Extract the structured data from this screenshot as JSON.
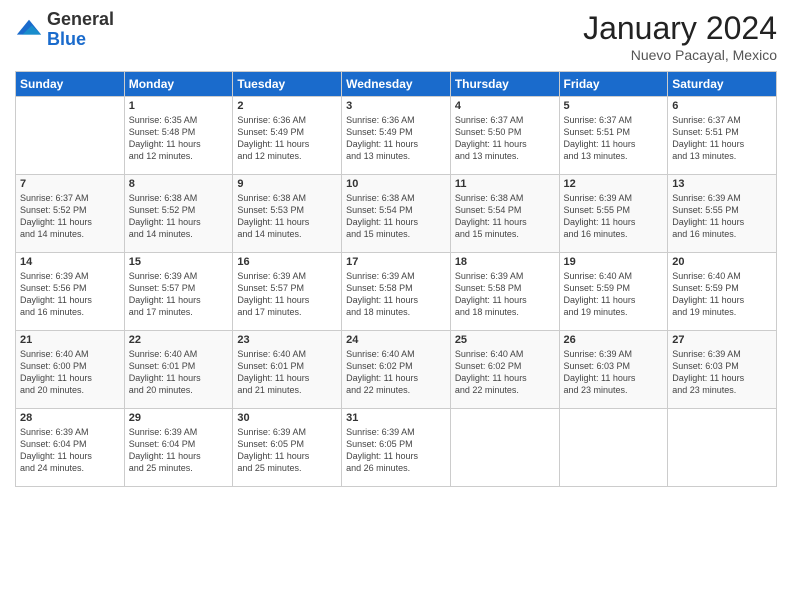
{
  "logo": {
    "general": "General",
    "blue": "Blue"
  },
  "title": "January 2024",
  "subtitle": "Nuevo Pacayal, Mexico",
  "days_header": [
    "Sunday",
    "Monday",
    "Tuesday",
    "Wednesday",
    "Thursday",
    "Friday",
    "Saturday"
  ],
  "weeks": [
    [
      {
        "num": "",
        "info": ""
      },
      {
        "num": "1",
        "info": "Sunrise: 6:35 AM\nSunset: 5:48 PM\nDaylight: 11 hours\nand 12 minutes."
      },
      {
        "num": "2",
        "info": "Sunrise: 6:36 AM\nSunset: 5:49 PM\nDaylight: 11 hours\nand 12 minutes."
      },
      {
        "num": "3",
        "info": "Sunrise: 6:36 AM\nSunset: 5:49 PM\nDaylight: 11 hours\nand 13 minutes."
      },
      {
        "num": "4",
        "info": "Sunrise: 6:37 AM\nSunset: 5:50 PM\nDaylight: 11 hours\nand 13 minutes."
      },
      {
        "num": "5",
        "info": "Sunrise: 6:37 AM\nSunset: 5:51 PM\nDaylight: 11 hours\nand 13 minutes."
      },
      {
        "num": "6",
        "info": "Sunrise: 6:37 AM\nSunset: 5:51 PM\nDaylight: 11 hours\nand 13 minutes."
      }
    ],
    [
      {
        "num": "7",
        "info": "Sunrise: 6:37 AM\nSunset: 5:52 PM\nDaylight: 11 hours\nand 14 minutes."
      },
      {
        "num": "8",
        "info": "Sunrise: 6:38 AM\nSunset: 5:52 PM\nDaylight: 11 hours\nand 14 minutes."
      },
      {
        "num": "9",
        "info": "Sunrise: 6:38 AM\nSunset: 5:53 PM\nDaylight: 11 hours\nand 14 minutes."
      },
      {
        "num": "10",
        "info": "Sunrise: 6:38 AM\nSunset: 5:54 PM\nDaylight: 11 hours\nand 15 minutes."
      },
      {
        "num": "11",
        "info": "Sunrise: 6:38 AM\nSunset: 5:54 PM\nDaylight: 11 hours\nand 15 minutes."
      },
      {
        "num": "12",
        "info": "Sunrise: 6:39 AM\nSunset: 5:55 PM\nDaylight: 11 hours\nand 16 minutes."
      },
      {
        "num": "13",
        "info": "Sunrise: 6:39 AM\nSunset: 5:55 PM\nDaylight: 11 hours\nand 16 minutes."
      }
    ],
    [
      {
        "num": "14",
        "info": "Sunrise: 6:39 AM\nSunset: 5:56 PM\nDaylight: 11 hours\nand 16 minutes."
      },
      {
        "num": "15",
        "info": "Sunrise: 6:39 AM\nSunset: 5:57 PM\nDaylight: 11 hours\nand 17 minutes."
      },
      {
        "num": "16",
        "info": "Sunrise: 6:39 AM\nSunset: 5:57 PM\nDaylight: 11 hours\nand 17 minutes."
      },
      {
        "num": "17",
        "info": "Sunrise: 6:39 AM\nSunset: 5:58 PM\nDaylight: 11 hours\nand 18 minutes."
      },
      {
        "num": "18",
        "info": "Sunrise: 6:39 AM\nSunset: 5:58 PM\nDaylight: 11 hours\nand 18 minutes."
      },
      {
        "num": "19",
        "info": "Sunrise: 6:40 AM\nSunset: 5:59 PM\nDaylight: 11 hours\nand 19 minutes."
      },
      {
        "num": "20",
        "info": "Sunrise: 6:40 AM\nSunset: 5:59 PM\nDaylight: 11 hours\nand 19 minutes."
      }
    ],
    [
      {
        "num": "21",
        "info": "Sunrise: 6:40 AM\nSunset: 6:00 PM\nDaylight: 11 hours\nand 20 minutes."
      },
      {
        "num": "22",
        "info": "Sunrise: 6:40 AM\nSunset: 6:01 PM\nDaylight: 11 hours\nand 20 minutes."
      },
      {
        "num": "23",
        "info": "Sunrise: 6:40 AM\nSunset: 6:01 PM\nDaylight: 11 hours\nand 21 minutes."
      },
      {
        "num": "24",
        "info": "Sunrise: 6:40 AM\nSunset: 6:02 PM\nDaylight: 11 hours\nand 22 minutes."
      },
      {
        "num": "25",
        "info": "Sunrise: 6:40 AM\nSunset: 6:02 PM\nDaylight: 11 hours\nand 22 minutes."
      },
      {
        "num": "26",
        "info": "Sunrise: 6:39 AM\nSunset: 6:03 PM\nDaylight: 11 hours\nand 23 minutes."
      },
      {
        "num": "27",
        "info": "Sunrise: 6:39 AM\nSunset: 6:03 PM\nDaylight: 11 hours\nand 23 minutes."
      }
    ],
    [
      {
        "num": "28",
        "info": "Sunrise: 6:39 AM\nSunset: 6:04 PM\nDaylight: 11 hours\nand 24 minutes."
      },
      {
        "num": "29",
        "info": "Sunrise: 6:39 AM\nSunset: 6:04 PM\nDaylight: 11 hours\nand 25 minutes."
      },
      {
        "num": "30",
        "info": "Sunrise: 6:39 AM\nSunset: 6:05 PM\nDaylight: 11 hours\nand 25 minutes."
      },
      {
        "num": "31",
        "info": "Sunrise: 6:39 AM\nSunset: 6:05 PM\nDaylight: 11 hours\nand 26 minutes."
      },
      {
        "num": "",
        "info": ""
      },
      {
        "num": "",
        "info": ""
      },
      {
        "num": "",
        "info": ""
      }
    ]
  ]
}
